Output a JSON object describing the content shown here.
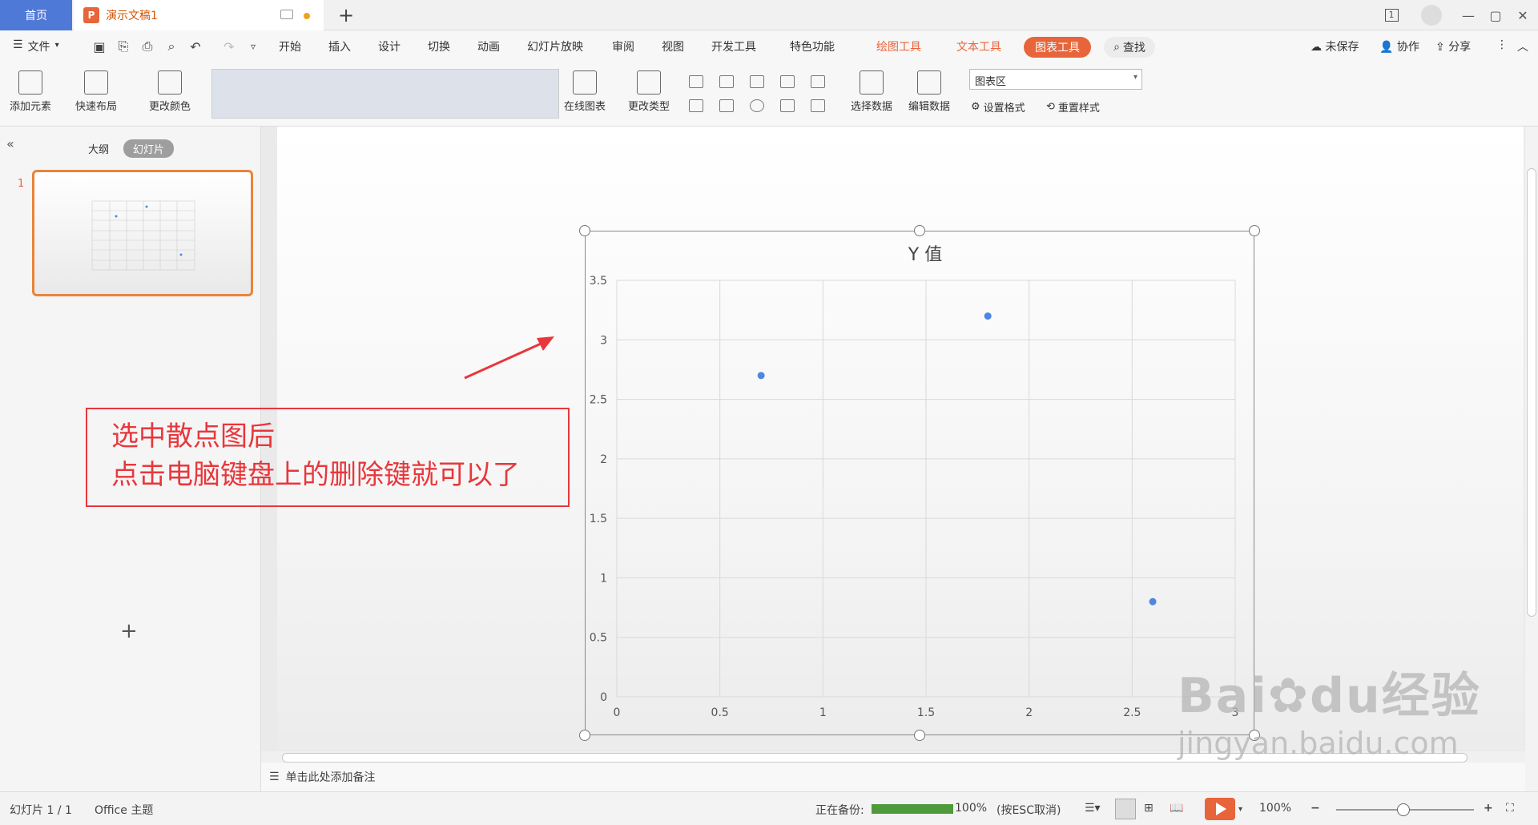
{
  "tabs": {
    "home": "首页",
    "doc": "演示文稿1",
    "add": "+"
  },
  "window": {
    "minimize": "—",
    "maximize": "▢",
    "close": "✕"
  },
  "menu": {
    "file": "文件",
    "items": [
      "开始",
      "插入",
      "设计",
      "切换",
      "动画",
      "幻灯片放映",
      "审阅",
      "视图",
      "开发工具",
      "特色功能"
    ],
    "context_tools": [
      "绘图工具",
      "文本工具"
    ],
    "active_tool": "图表工具",
    "search": "查找",
    "right": {
      "unsaved": "未保存",
      "collab": "协作",
      "share": "分享"
    }
  },
  "toolbar": {
    "add_element": "添加元素",
    "quick_layout": "快速布局",
    "change_color": "更改颜色",
    "online_chart": "在线图表",
    "change_type": "更改类型",
    "select_data": "选择数据",
    "edit_data": "编辑数据",
    "chart_area": "图表区",
    "set_format": "设置格式",
    "reset_style": "重置样式"
  },
  "left_panel": {
    "outline": "大纲",
    "slides": "幻灯片",
    "slide_number": "1",
    "add": "+"
  },
  "notes": {
    "placeholder": "单击此处添加备注"
  },
  "callout": {
    "line1": "选中散点图后",
    "line2": "点击电脑键盘上的删除键就可以了"
  },
  "chart_data": {
    "type": "scatter",
    "title": "Y 值",
    "xlim": [
      0,
      3
    ],
    "ylim": [
      0,
      3.5
    ],
    "xticks": [
      "0",
      "0.5",
      "1",
      "1.5",
      "2",
      "2.5",
      "3"
    ],
    "yticks": [
      "0",
      "0.5",
      "1",
      "1.5",
      "2",
      "2.5",
      "3",
      "3.5"
    ],
    "grid": true,
    "series": [
      {
        "x": [
          0.7,
          1.8,
          2.6
        ],
        "y": [
          2.7,
          3.2,
          0.8
        ]
      }
    ],
    "color": "#4f86e0"
  },
  "status": {
    "slide_info": "幻灯片 1 / 1",
    "theme": "Office 主题",
    "backup_label": "正在备份:",
    "backup_pct": "100%",
    "backup_progress": 1.0,
    "esc": "(按ESC取消)",
    "zoom": "100%",
    "minus": "−",
    "plus": "+"
  },
  "watermark": {
    "brand": "Bai",
    "brand2": "du",
    "site": "经验",
    "url": "jingyan.baidu.com"
  }
}
